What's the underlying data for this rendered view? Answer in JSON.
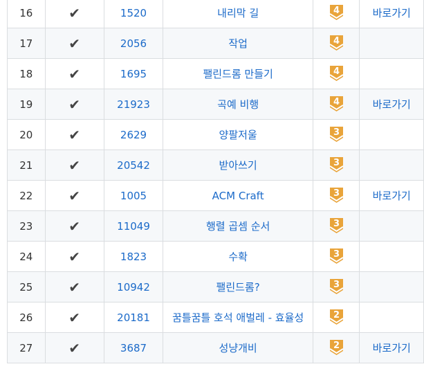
{
  "rows": [
    {
      "num": "16",
      "check": "✔",
      "id": "1520",
      "title": "내리막 길",
      "level": "4",
      "shortcut": "바로가기"
    },
    {
      "num": "17",
      "check": "✔",
      "id": "2056",
      "title": "작업",
      "level": "4",
      "shortcut": ""
    },
    {
      "num": "18",
      "check": "✔",
      "id": "1695",
      "title": "팰린드롬 만들기",
      "level": "4",
      "shortcut": ""
    },
    {
      "num": "19",
      "check": "✔",
      "id": "21923",
      "title": "곡예 비행",
      "level": "4",
      "shortcut": "바로가기"
    },
    {
      "num": "20",
      "check": "✔",
      "id": "2629",
      "title": "양팔저울",
      "level": "3",
      "shortcut": ""
    },
    {
      "num": "21",
      "check": "✔",
      "id": "20542",
      "title": "받아쓰기",
      "level": "3",
      "shortcut": ""
    },
    {
      "num": "22",
      "check": "✔",
      "id": "1005",
      "title": "ACM Craft",
      "level": "3",
      "shortcut": "바로가기"
    },
    {
      "num": "23",
      "check": "✔",
      "id": "11049",
      "title": "행렬 곱셈 순서",
      "level": "3",
      "shortcut": ""
    },
    {
      "num": "24",
      "check": "✔",
      "id": "1823",
      "title": "수확",
      "level": "3",
      "shortcut": ""
    },
    {
      "num": "25",
      "check": "✔",
      "id": "10942",
      "title": "팰린드롬?",
      "level": "3",
      "shortcut": ""
    },
    {
      "num": "26",
      "check": "✔",
      "id": "20181",
      "title": "꿈틀꿈틀 호석 애벌레 - 효율성",
      "level": "2",
      "shortcut": ""
    },
    {
      "num": "27",
      "check": "✔",
      "id": "3687",
      "title": "성냥개비",
      "level": "2",
      "shortcut": "바로가기"
    }
  ],
  "colors": {
    "badge_gold": "#e9a43a",
    "badge_gold_dark": "#c98418",
    "link_blue": "#1b6ac9",
    "row_alt": "#f6f8fa",
    "border": "#dadde0"
  },
  "icons": {
    "check": "check-icon",
    "badge": "tier-badge-icon"
  }
}
